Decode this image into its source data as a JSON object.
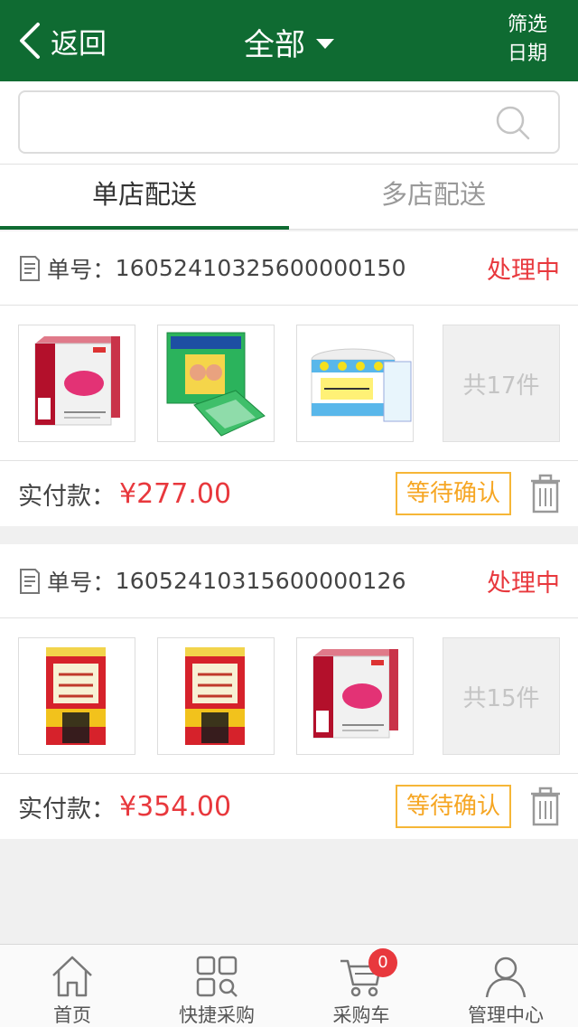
{
  "header": {
    "back_label": "返回",
    "title": "全部",
    "filter_line1": "筛选",
    "filter_line2": "日期",
    "color": "#0f6b32"
  },
  "search": {
    "placeholder": "",
    "value": ""
  },
  "tabs": [
    {
      "label": "单店配送",
      "active": true
    },
    {
      "label": "多店配送",
      "active": false
    }
  ],
  "orders": [
    {
      "number_label": "单号：",
      "number": "160524103256000001​50",
      "status": "处理中",
      "products": [
        "red-box-product",
        "green-packet-product",
        "tiger-balm-product"
      ],
      "item_count": "共17件",
      "paid_label": "实付款：",
      "paid_amount": "¥277.00",
      "action": "等待确认"
    },
    {
      "number_label": "单号：",
      "number": "160524103156000001​26",
      "status": "处理中",
      "products": [
        "red-yellow-box-product",
        "red-yellow-box-product",
        "red-box-product"
      ],
      "item_count": "共15件",
      "paid_label": "实付款：",
      "paid_amount": "¥354.00",
      "action": "等待确认"
    }
  ],
  "bottom_nav": [
    {
      "label": "首页",
      "icon": "home-icon"
    },
    {
      "label": "快捷采购",
      "icon": "grid-search-icon"
    },
    {
      "label": "采购车",
      "icon": "cart-icon",
      "badge": "0"
    },
    {
      "label": "管理中心",
      "icon": "user-icon"
    }
  ],
  "colors": {
    "accent": "#0f6b32",
    "status": "#e8383d",
    "action_border": "#f6b637"
  }
}
